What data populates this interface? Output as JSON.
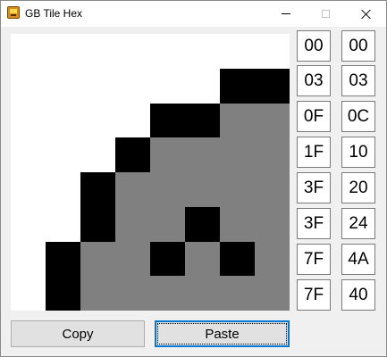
{
  "window": {
    "title": "GB Tile Hex",
    "icon": "gameboy-app-icon"
  },
  "tile": {
    "palette": [
      "#ffffff",
      "#d3d3d3",
      "#808080",
      "#000000"
    ],
    "pixels": [
      [
        0,
        0,
        0,
        0,
        0,
        0,
        0,
        0
      ],
      [
        0,
        0,
        0,
        0,
        0,
        0,
        3,
        3
      ],
      [
        0,
        0,
        0,
        0,
        3,
        3,
        2,
        2
      ],
      [
        0,
        0,
        0,
        3,
        2,
        2,
        2,
        2
      ],
      [
        0,
        0,
        3,
        2,
        2,
        2,
        2,
        2
      ],
      [
        0,
        0,
        3,
        2,
        2,
        3,
        2,
        2
      ],
      [
        0,
        3,
        2,
        2,
        3,
        2,
        3,
        2
      ],
      [
        0,
        3,
        2,
        2,
        2,
        2,
        2,
        2
      ]
    ]
  },
  "hex": {
    "low": [
      "00",
      "03",
      "0F",
      "1F",
      "3F",
      "3F",
      "7F",
      "7F"
    ],
    "high": [
      "00",
      "03",
      "0C",
      "10",
      "20",
      "24",
      "4A",
      "40"
    ]
  },
  "buttons": {
    "copy_label": "Copy",
    "paste_label": "Paste"
  }
}
